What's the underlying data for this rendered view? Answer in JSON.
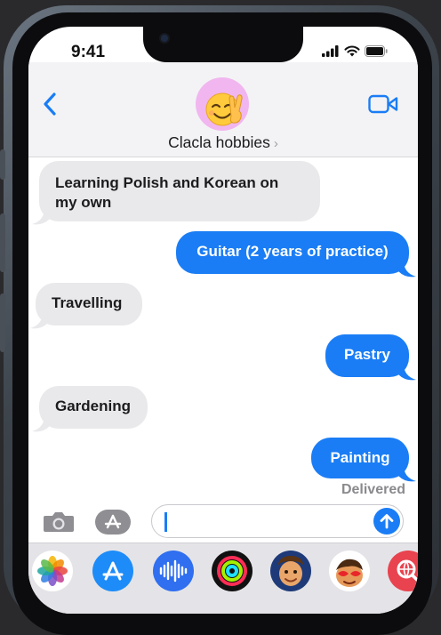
{
  "status_bar": {
    "time": "9:41"
  },
  "header": {
    "contact_name": "Clacla hobbies",
    "chevron": "›",
    "avatar_icon": "smiling-face-victory-hand-memoji",
    "back_icon": "chevron-left-icon",
    "video_icon": "video-camera-icon"
  },
  "messages": [
    {
      "direction": "incoming",
      "text_lines": [
        "Learning Polish and Korean on",
        "my own"
      ]
    },
    {
      "direction": "outgoing",
      "text": "Guitar (2 years of practice)"
    },
    {
      "direction": "incoming",
      "text": "Travelling"
    },
    {
      "direction": "outgoing",
      "text": "Pastry"
    },
    {
      "direction": "incoming",
      "text": "Gardening"
    },
    {
      "direction": "outgoing",
      "text": "Painting"
    }
  ],
  "delivery_status": "Delivered",
  "composer": {
    "value": "",
    "placeholder": "",
    "camera_icon": "camera-icon",
    "apps_icon": "app-store-icon",
    "send_icon": "arrow-up-icon"
  },
  "app_tray": [
    "photos-icon",
    "app-store-icon",
    "audio-waveform-icon",
    "activity-rings-icon",
    "memoji-icon",
    "memoji-stickers-icon",
    "web-search-icon"
  ],
  "colors": {
    "accent": "#1a7df5",
    "incoming_bubble": "#e9e9eb",
    "header_bg": "#f3f3f5"
  }
}
